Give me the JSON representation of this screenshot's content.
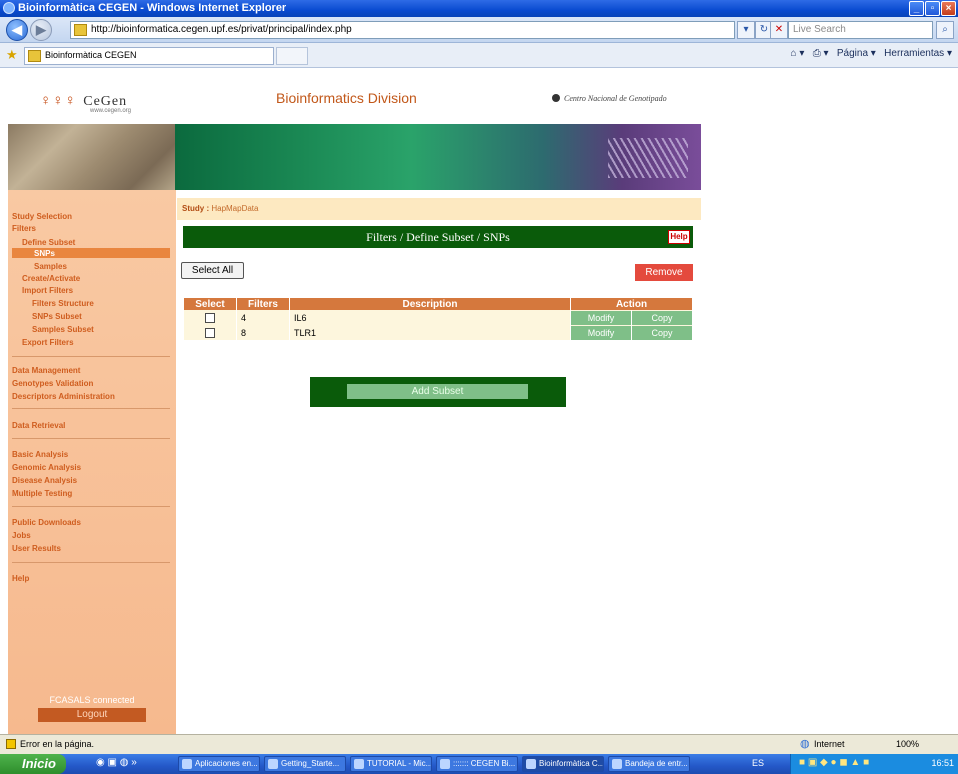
{
  "window": {
    "title": "Bioinformàtica CEGEN - Windows Internet Explorer"
  },
  "browser": {
    "url": "http://bioinformatica.cegen.upf.es/privat/principal/index.php",
    "search_placeholder": "Live Search",
    "tab_title": "Bioinformàtica CEGEN",
    "tools": [
      "Página",
      "Herramientas"
    ]
  },
  "header": {
    "logo_text": "CeGen",
    "logo_sub": "www.cegen.org",
    "division": "Bioinformatics Division",
    "center": "Centro Nacional de Genotipado"
  },
  "sidebar": {
    "items": [
      {
        "label": "Study Selection"
      },
      {
        "label": "Filters"
      },
      {
        "label": "Define Subset"
      },
      {
        "label": "SNPs"
      },
      {
        "label": "Samples"
      },
      {
        "label": "Create/Activate"
      },
      {
        "label": "Import Filters"
      },
      {
        "label": "Filters Structure"
      },
      {
        "label": "SNPs Subset"
      },
      {
        "label": "Samples Subset"
      },
      {
        "label": "Export Filters"
      },
      {
        "label": "Data Management"
      },
      {
        "label": "Genotypes Validation"
      },
      {
        "label": "Descriptors Administration"
      },
      {
        "label": "Data Retrieval"
      },
      {
        "label": "Basic Analysis"
      },
      {
        "label": "Genomic Analysis"
      },
      {
        "label": "Disease Analysis"
      },
      {
        "label": "Multiple Testing"
      },
      {
        "label": "Public Downloads"
      },
      {
        "label": "Jobs"
      },
      {
        "label": "User Results"
      },
      {
        "label": "Help"
      }
    ],
    "connected": "FCASALS connected",
    "logout": "Logout"
  },
  "main": {
    "study_key": "Study :",
    "study_value": "HapMapData",
    "section_title": "Filters / Define Subset / SNPs",
    "help": "Help",
    "select_all": "Select All",
    "remove": "Remove",
    "table": {
      "headers": [
        "Select",
        "Filters",
        "Description",
        "Action"
      ],
      "rows": [
        {
          "filters": "4",
          "description": "IL6",
          "modify": "Modify",
          "copy": "Copy"
        },
        {
          "filters": "8",
          "description": "TLR1",
          "modify": "Modify",
          "copy": "Copy"
        }
      ]
    },
    "add_subset": "Add Subset"
  },
  "status": {
    "left": "Error en la página.",
    "zone": "Internet",
    "zoom": "100%"
  },
  "taskbar": {
    "start": "Inicio",
    "tasks": [
      "Aplicaciones en...",
      "Getting_Starte...",
      "TUTORIAL - Mic...",
      "::::::: CEGEN Bi...",
      "Bioinformàtica C...",
      "Bandeja de entr..."
    ],
    "lang": "ES",
    "clock": "16:51"
  }
}
